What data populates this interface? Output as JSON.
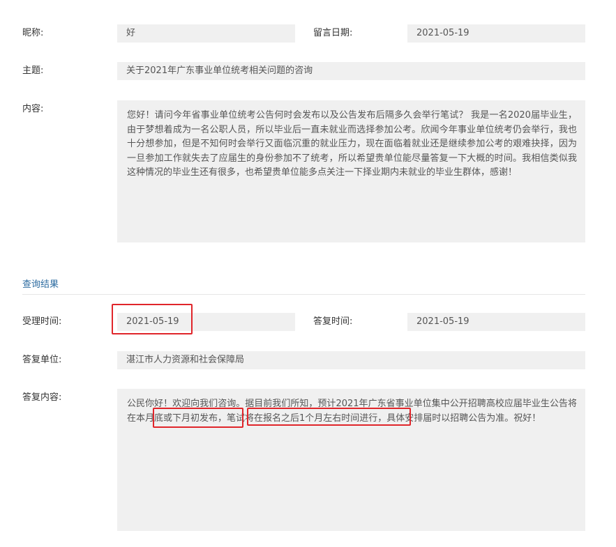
{
  "inquiry": {
    "nickname_label": "昵称:",
    "nickname_value": "好",
    "date_label": "留言日期:",
    "date_value": "2021-05-19",
    "subject_label": "主题:",
    "subject_value": "关于2021年广东事业单位统考相关问题的咨询",
    "content_label": "内容:",
    "content_value": "您好！请问今年省事业单位统考公告何时会发布以及公告发布后隔多久会举行笔试？ 我是一名2020届毕业生，由于梦想着成为一名公职人员，所以毕业后一直未就业而选择参加公考。欣闻今年事业单位统考仍会举行，我也十分想参加，但是不知何时会举行又面临沉重的就业压力，现在面临着就业还是继续参加公考的艰难抉择，因为一旦参加工作就失去了应届生的身份参加不了统考，所以希望贵单位能尽量答复一下大概的时间。我相信类似我这种情况的毕业生还有很多，也希望贵单位能多点关注一下择业期内未就业的毕业生群体，感谢！"
  },
  "result": {
    "section_title": "查询结果",
    "accept_time_label": "受理时间:",
    "accept_time_value": "2021-05-19",
    "reply_time_label": "答复时间:",
    "reply_time_value": "2021-05-19",
    "reply_unit_label": "答复单位:",
    "reply_unit_value": "湛江市人力资源和社会保障局",
    "reply_content_label": "答复内容:",
    "reply_content_value": "公民你好！欢迎向我们咨询。据目前我们所知，预计2021年广东省事业单位集中公开招聘高校应届毕业生公告将在本月底或下月初发布，笔试将在报名之后1个月左右时间进行，具体安排届时以招聘公告为准。祝好！"
  },
  "colors": {
    "highlight_border": "#e0252a",
    "field_background": "#f0f0f0",
    "section_title": "#2c6ba0"
  }
}
